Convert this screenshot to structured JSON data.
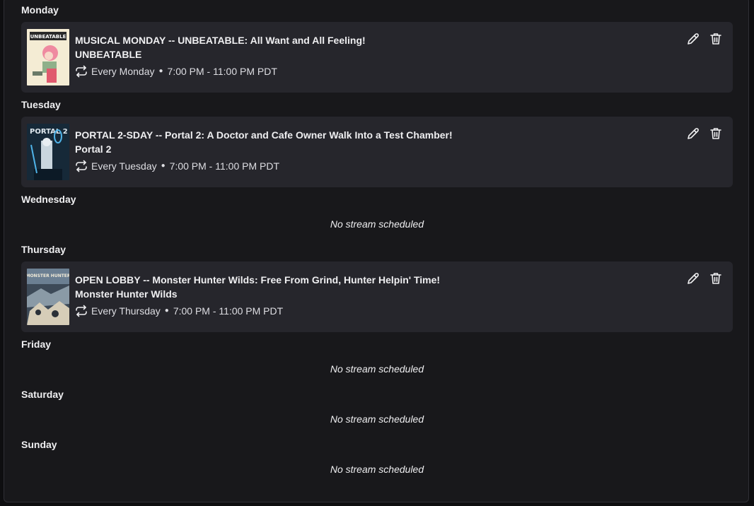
{
  "schedule": {
    "days": [
      {
        "label": "Monday",
        "segment": {
          "title": "MUSICAL MONDAY -- UNBEATABLE: All Want and All Feeling!",
          "game": "UNBEATABLE",
          "recurrence": "Every Monday",
          "time": "7:00 PM - 11:00 PM PDT",
          "thumb_colors": [
            "#f3e9cf",
            "#e9708a",
            "#3a4a3a"
          ]
        }
      },
      {
        "label": "Tuesday",
        "segment": {
          "title": "PORTAL 2-SDAY -- Portal 2: A Doctor and Cafe Owner Walk Into a Test Chamber!",
          "game": "Portal 2",
          "recurrence": "Every Tuesday",
          "time": "7:00 PM - 11:00 PM PDT",
          "thumb_colors": [
            "#1b3144",
            "#4fb3e8",
            "#cfd9df"
          ]
        }
      },
      {
        "label": "Wednesday",
        "empty_text": "No stream scheduled"
      },
      {
        "label": "Thursday",
        "segment": {
          "title": "OPEN LOBBY -- Monster Hunter Wilds: Free From Grind, Hunter Helpin' Time!",
          "game": "Monster Hunter Wilds",
          "recurrence": "Every Thursday",
          "time": "7:00 PM - 11:00 PM PDT",
          "thumb_colors": [
            "#2b3a4c",
            "#8aa3b8",
            "#d9d2c0"
          ]
        }
      },
      {
        "label": "Friday",
        "empty_text": "No stream scheduled"
      },
      {
        "label": "Saturday",
        "empty_text": "No stream scheduled"
      },
      {
        "label": "Sunday",
        "empty_text": "No stream scheduled"
      }
    ]
  },
  "icons": {
    "repeat": "repeat-icon",
    "edit": "pencil-icon",
    "delete": "trash-icon"
  },
  "colors": {
    "panel_bg": "#18181b",
    "card_bg": "#26262c",
    "text": "#efeff1"
  }
}
